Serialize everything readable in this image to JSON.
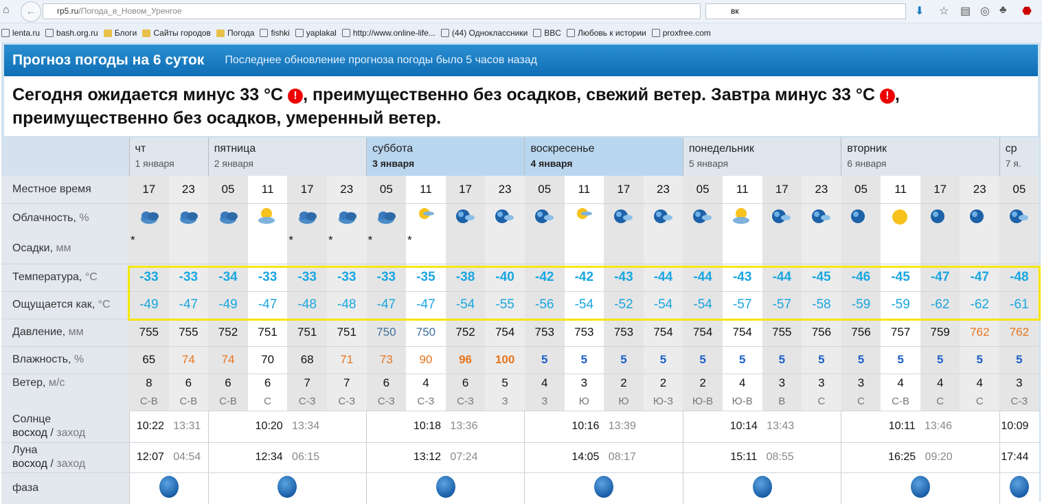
{
  "browser": {
    "url_host": "rp5.ru",
    "url_path": "/Погода_в_Новом_Уренгое",
    "search_value": "вк",
    "bookmarks": [
      "lenta.ru",
      "bash.org.ru",
      "Блоги",
      "Сайты городов",
      "Погода",
      "fishki",
      "yaplakal",
      "http://www.online-life...",
      "(44) Одноклассники",
      "BBC",
      "Любовь к истории",
      "proxfree.com"
    ]
  },
  "header": {
    "title": "Прогноз погоды на 6 суток",
    "update": "Последнее обновление прогноза погоды было 5 часов назад"
  },
  "summary": {
    "p1": "Сегодня ожидается минус 33 °C ",
    "p2": ", преимущественно без осадков, свежий ветер. Завтра минус 33 °C ",
    "p3": ", преимущественно без осадков, умеренный ветер.",
    "warn": "!"
  },
  "days": [
    {
      "name": "чт",
      "date": "1 января",
      "cols": 2
    },
    {
      "name": "пятница",
      "date": "2 января",
      "cols": 4
    },
    {
      "name": "суббота",
      "date": "3 января",
      "cols": 4,
      "selected": true
    },
    {
      "name": "воскресенье",
      "date": "4 января",
      "cols": 4,
      "selected": true
    },
    {
      "name": "понедельник",
      "date": "5 января",
      "cols": 4
    },
    {
      "name": "вторник",
      "date": "6 января",
      "cols": 4
    },
    {
      "name": "ср",
      "date": "7 я.",
      "cols": 1
    }
  ],
  "labels": {
    "time": "Местное время",
    "cloud": "Облачность,",
    "cloud_u": "%",
    "precip": "Осадки,",
    "precip_u": "мм",
    "temp": "Температура,",
    "temp_u": "°C",
    "feels": "Ощущается как,",
    "feels_u": "°C",
    "pressure": "Давление,",
    "pressure_u": "мм",
    "humidity": "Влажность,",
    "humidity_u": "%",
    "wind": "Ветер,",
    "wind_u": "м/с",
    "sun": "Солнце",
    "rise": "восход",
    "set": "заход",
    "moon": "Луна",
    "phase": "фаза"
  },
  "hours": [
    "17",
    "23",
    "05",
    "11",
    "17",
    "23",
    "05",
    "11",
    "17",
    "23",
    "05",
    "11",
    "17",
    "23",
    "05",
    "11",
    "17",
    "23",
    "05",
    "11",
    "17",
    "23",
    "05"
  ],
  "clouds": [
    "overcast",
    "overcast",
    "overcast",
    "partly-sunny",
    "overcast",
    "overcast",
    "overcast",
    "sun-cloud",
    "night-cloud",
    "night-cloud",
    "night-cloud",
    "sun-cloud",
    "night-cloud",
    "night-cloud",
    "night-cloud",
    "partly-sunny",
    "night-cloud",
    "night-cloud",
    "night-clear",
    "sun",
    "night-clear",
    "night-clear",
    "night-cloud"
  ],
  "snow": [
    1,
    0,
    0,
    0,
    1,
    1,
    1,
    1,
    0,
    0,
    0,
    0,
    0,
    0,
    0,
    0,
    0,
    0,
    0,
    0,
    0,
    0,
    0
  ],
  "temp": [
    "-33",
    "-33",
    "-34",
    "-33",
    "-33",
    "-33",
    "-33",
    "-35",
    "-38",
    "-40",
    "-42",
    "-42",
    "-43",
    "-44",
    "-44",
    "-43",
    "-44",
    "-45",
    "-46",
    "-45",
    "-47",
    "-47",
    "-48"
  ],
  "feels": [
    "-49",
    "-47",
    "-49",
    "-47",
    "-48",
    "-48",
    "-47",
    "-47",
    "-54",
    "-55",
    "-56",
    "-54",
    "-52",
    "-54",
    "-54",
    "-57",
    "-57",
    "-58",
    "-59",
    "-59",
    "-62",
    "-62",
    "-61"
  ],
  "feels_dark": [
    20,
    21,
    22
  ],
  "pressure": [
    "755",
    "755",
    "752",
    "751",
    "751",
    "751",
    "750",
    "750",
    "752",
    "754",
    "753",
    "753",
    "753",
    "754",
    "754",
    "754",
    "755",
    "756",
    "756",
    "757",
    "759",
    "762",
    "762"
  ],
  "pressure_style": [
    "",
    "",
    "",
    "",
    "",
    "",
    "bg",
    "bg",
    "",
    "",
    "",
    "",
    "",
    "",
    "",
    "",
    "",
    "",
    "",
    "",
    "",
    "or",
    "or"
  ],
  "humidity": [
    "65",
    "74",
    "74",
    "70",
    "68",
    "71",
    "73",
    "90",
    "96",
    "100",
    "5",
    "5",
    "5",
    "5",
    "5",
    "5",
    "5",
    "5",
    "5",
    "5",
    "5",
    "5",
    "5"
  ],
  "humidity_style": [
    "",
    "or",
    "or",
    "",
    "",
    "or",
    "or",
    "or",
    "orb",
    "orb",
    "bl",
    "bl",
    "bl",
    "bl",
    "bl",
    "bl",
    "bl",
    "bl",
    "bl",
    "bl",
    "bl",
    "bl",
    "bl"
  ],
  "wind": [
    "8",
    "6",
    "6",
    "6",
    "7",
    "7",
    "6",
    "4",
    "6",
    "5",
    "4",
    "3",
    "2",
    "2",
    "2",
    "4",
    "3",
    "3",
    "3",
    "4",
    "4",
    "4",
    "3"
  ],
  "wind_dir": [
    "С-В",
    "С-В",
    "С-В",
    "С",
    "С-З",
    "С-З",
    "С-З",
    "С-З",
    "С-З",
    "З",
    "З",
    "Ю",
    "Ю",
    "Ю-З",
    "Ю-В",
    "Ю-В",
    "В",
    "С",
    "С",
    "С-В",
    "С",
    "С",
    "С-З"
  ],
  "sun": [
    [
      "10:22",
      "13:31"
    ],
    [
      "10:20",
      "13:34"
    ],
    [
      "10:18",
      "13:36"
    ],
    [
      "10:16",
      "13:39"
    ],
    [
      "10:14",
      "13:43"
    ],
    [
      "10:11",
      "13:46"
    ],
    [
      "10:09",
      ""
    ]
  ],
  "moon": [
    [
      "12:07",
      "04:54"
    ],
    [
      "12:34",
      "06:15"
    ],
    [
      "13:12",
      "07:24"
    ],
    [
      "14:05",
      "08:17"
    ],
    [
      "15:11",
      "08:55"
    ],
    [
      "16:25",
      "09:20"
    ],
    [
      "17:44",
      ""
    ]
  ],
  "colors": {
    "header": "#1a7cc2",
    "temp": "#1aa6e0",
    "highlight": "#f5e600",
    "orange": "#e8741c"
  }
}
